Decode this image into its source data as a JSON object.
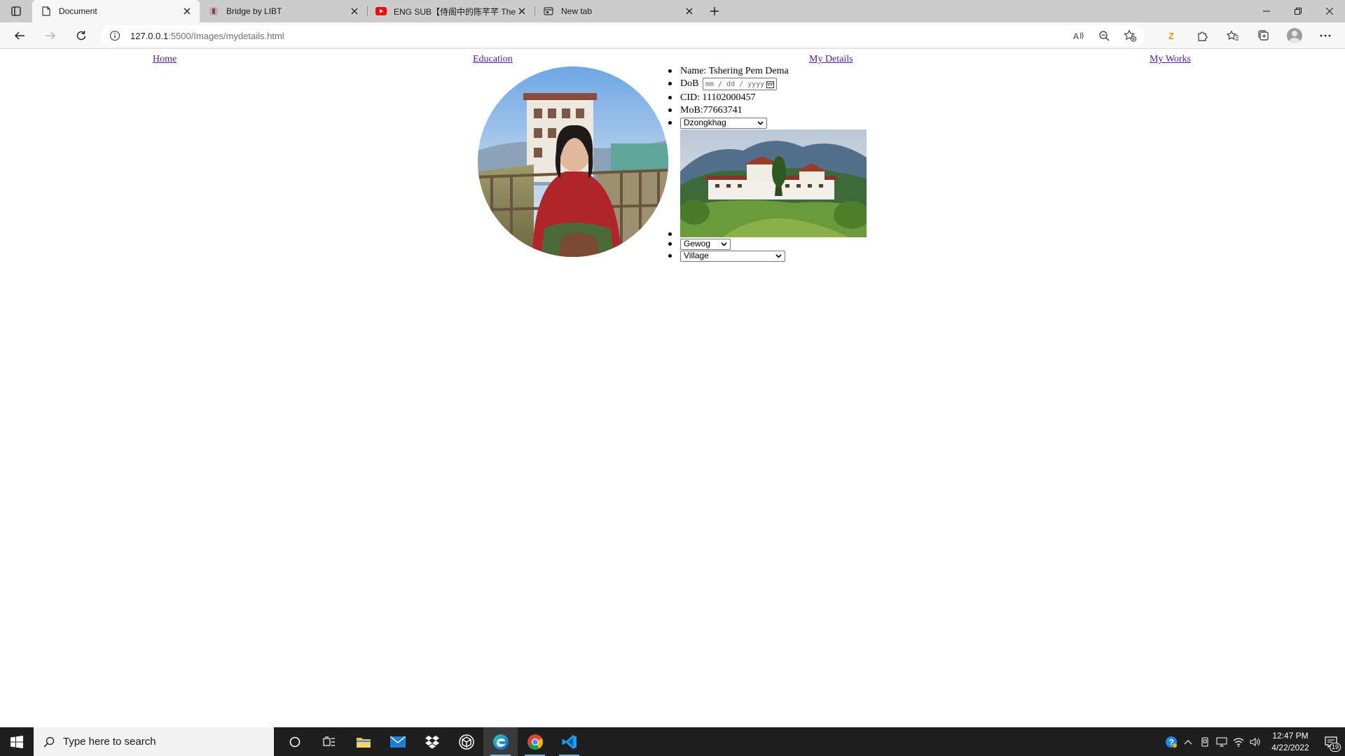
{
  "browser": {
    "tabs": [
      {
        "title": "Document",
        "favicon": "document-icon",
        "active": true
      },
      {
        "title": "Bridge by LIBT",
        "favicon": "libt-favicon",
        "active": false
      },
      {
        "title": "ENG SUB【侍阁中的陈芊芊 The R",
        "favicon": "youtube-icon",
        "active": false
      },
      {
        "title": "New tab",
        "favicon": "newtab-icon",
        "active": false
      }
    ],
    "url_host": "127.0.0.1",
    "url_path": ":5500/Images/mydetails.html"
  },
  "page": {
    "nav": {
      "home": "Home",
      "education": "Education",
      "my_details": "My Details",
      "my_works": "My Works"
    },
    "details": {
      "name_label": "Name: Tshering Pem Dema",
      "dob_label": "DoB",
      "dob_placeholder": "mm / dd / yyyy",
      "cid_label": "CID: 11102000457",
      "mob_label": "MoB:77663741",
      "dzongkhag_selected": "Dzongkhag",
      "gewog_selected": "Gewog",
      "village_selected": "Village"
    }
  },
  "taskbar": {
    "search_placeholder": "Type here to search",
    "time": "12:47 PM",
    "date": "4/22/2022",
    "notification_count": "19",
    "apps": [
      "cortana-icon",
      "task-view-icon",
      "file-explorer-icon",
      "mail-icon",
      "dropbox-icon",
      "unity-icon",
      "edge-icon",
      "chrome-icon",
      "vscode-icon"
    ]
  },
  "colors": {
    "link_visited": "#551a8b",
    "tabstrip_bg": "#cccccc",
    "taskbar_bg": "#1f1f1f"
  }
}
